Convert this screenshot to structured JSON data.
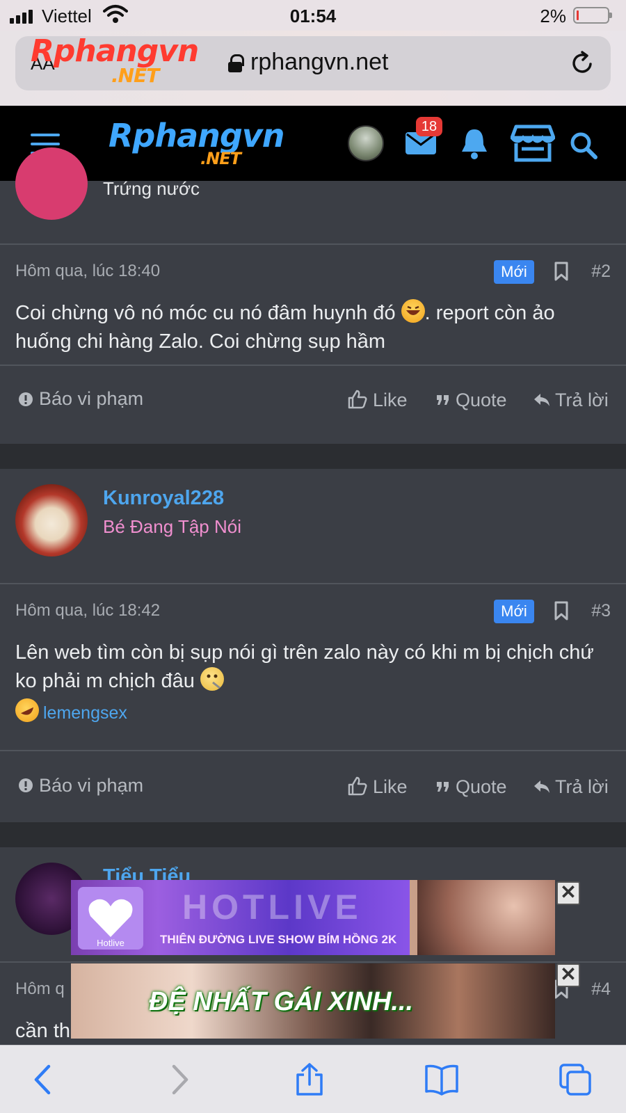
{
  "status": {
    "carrier": "Viettel",
    "time": "01:54",
    "battery": "2%"
  },
  "browser": {
    "aa": "AA",
    "url": "rphangvn.net"
  },
  "site": {
    "logo_main": "Rphangvn",
    "logo_net": ".NET",
    "inbox_badge": "18"
  },
  "posts": [
    {
      "user_title": "Trứng nước",
      "date": "Hôm qua, lúc 18:40",
      "new_label": "Mới",
      "num": "#2",
      "body_a": "Coi chừng vô nó móc cu nó đâm huynh đó ",
      "body_b": ". report còn ảo huống chi hàng Zalo. Coi chừng sụp hầm",
      "report": "Báo vi phạm",
      "like": "Like",
      "quote": "Quote",
      "reply": "Trả lời"
    },
    {
      "username": "Kunroyal228",
      "user_title": "Bé Đang Tập Nói",
      "date": "Hôm qua, lúc 18:42",
      "new_label": "Mới",
      "num": "#3",
      "body_a": "Lên web tìm còn bị sụp nói gì trên zalo này có khi m bị chịch chứ ko phải m chịch đâu ",
      "reaction_user": "lemengsex",
      "report": "Báo vi phạm",
      "like": "Like",
      "quote": "Quote",
      "reply": "Trả lời"
    },
    {
      "username": "Tiểu Tiểu",
      "date_partial": "Hôm q",
      "num": "#4",
      "body_partial": "cần th"
    }
  ],
  "ads": [
    {
      "brand": "Hotlive",
      "title": "HOTLIVE",
      "caption": "THIÊN ĐƯỜNG LIVE SHOW BÍM HỒNG 2K",
      "close": "✕"
    },
    {
      "caption": "ĐỆ NHẤT GÁI XINH...",
      "close": "✕"
    }
  ],
  "colors": {
    "accent": "#4ea6ee",
    "new_badge": "#3a86f0",
    "user_title_pink": "#f08fcf",
    "bg": "#3b3e45"
  }
}
